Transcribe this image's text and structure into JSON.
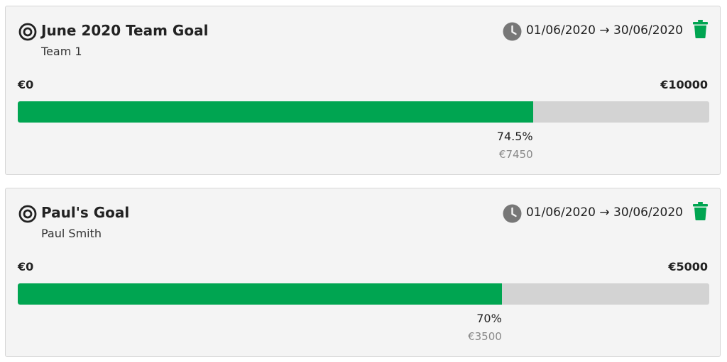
{
  "goals": [
    {
      "title": "June 2020 Team Goal",
      "owner": "Team 1",
      "date_range": "01/06/2020 → 30/06/2020",
      "min_label": "€0",
      "max_label": "€10000",
      "progress_percent": 74.5,
      "progress_label": "74.5%",
      "amount_label": "€7450",
      "icons": {
        "goal": "target-icon",
        "clock": "clock-icon",
        "delete": "trash-icon"
      }
    },
    {
      "title": "Paul's Goal",
      "owner": "Paul Smith",
      "date_range": "01/06/2020 → 30/06/2020",
      "min_label": "€0",
      "max_label": "€5000",
      "progress_percent": 70,
      "progress_label": "70%",
      "amount_label": "€3500",
      "icons": {
        "goal": "target-icon",
        "clock": "clock-icon",
        "delete": "trash-icon"
      }
    }
  ],
  "colors": {
    "progress_fill": "#00a551",
    "progress_track": "#d3d3d3",
    "delete_icon": "#00a551",
    "clock_icon": "#777777"
  }
}
